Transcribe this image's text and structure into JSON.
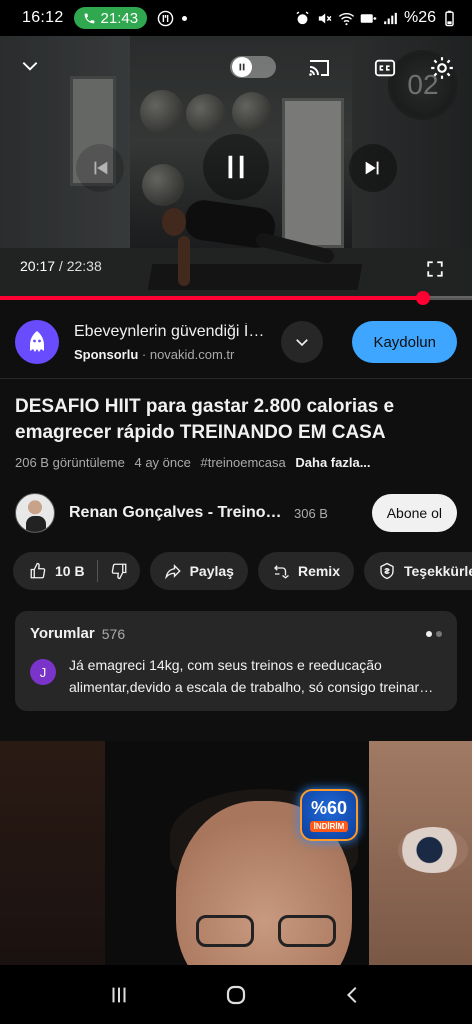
{
  "status_bar": {
    "time": "16:12",
    "call_time": "21:43",
    "battery": "%26",
    "icons": [
      "phone-icon",
      "alarm-icon",
      "mute-icon",
      "wifi-icon",
      "hd-plus-icon",
      "signal-icon",
      "battery-icon"
    ]
  },
  "player": {
    "current_time": "20:17",
    "separator": " / ",
    "total_time": "22:38",
    "progress": 0.896,
    "timer_overlay": "02",
    "accent": "#ff0033"
  },
  "ad": {
    "title": "Ebeveynlerin güvendiği İ…",
    "sponsored_label": "Sponsorlu",
    "dot": " · ",
    "domain": "novakid.com.tr",
    "cta_label": "Kaydolun",
    "cta_color": "#3ea6ff"
  },
  "video": {
    "title": "DESAFIO HIIT para gastar 2.800 calorias e emagrecer rápido TREINANDO EM CASA",
    "views": "206 B görüntüleme",
    "age": "4 ay önce",
    "hashtag": "#treinoemcasa",
    "more_label": "Daha fazla..."
  },
  "channel": {
    "name": "Renan Gonçalves - Treino…",
    "subscribers": "306 B",
    "subscribe_label": "Abone ol"
  },
  "actions": {
    "like_count": "10 B",
    "share_label": "Paylaş",
    "remix_label": "Remix",
    "thanks_label": "Teşekkürler"
  },
  "comments": {
    "title": "Yorumlar",
    "count": "576",
    "first_comment": {
      "avatar_letter": "J",
      "text": "Já emagreci 14kg, com seus treinos e reeducação alimentar,devido a escala de trabalho, só consigo treinar…"
    }
  },
  "next_video": {
    "badge_percent": "%60",
    "badge_word": "İNDİRİM"
  }
}
